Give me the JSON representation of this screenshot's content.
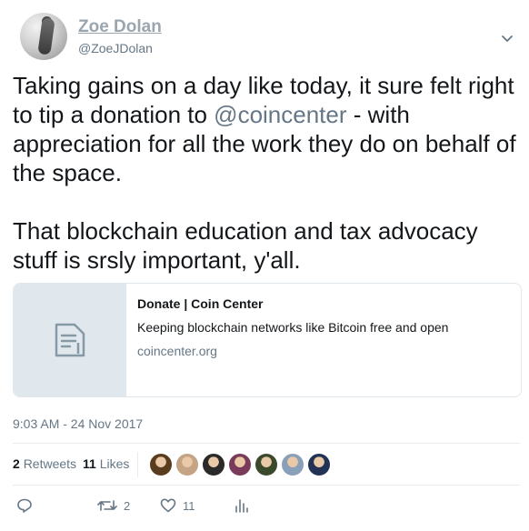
{
  "tweet": {
    "author": {
      "name": "Zoe Dolan",
      "handle": "@ZoeJDolan"
    },
    "text_before": "Taking gains on a day like today, it sure felt right to tip a donation to ",
    "mention": "@coincenter",
    "text_after": " - with appreciation for all the work they do on behalf of the space.\n\nThat blockchain education and tax advocacy stuff is srsly important, y'all.",
    "card": {
      "title": "Donate | Coin Center",
      "description": "Keeping blockchain networks like Bitcoin free and open",
      "domain": "coincenter.org"
    },
    "timestamp": "9:03 AM - 24 Nov 2017",
    "stats": {
      "retweets_count": "2",
      "retweets_label": "Retweets",
      "likes_count": "11",
      "likes_label": "Likes"
    },
    "liker_avatars": [
      "#5a3d1e",
      "#c4a484",
      "#2a2a2a",
      "#7a3b5a",
      "#3c4a2c",
      "#8aa0b8",
      "#223355"
    ],
    "actions": {
      "reply_icon": "reply-icon",
      "retweet_count": "2",
      "like_count": "11",
      "analytics_icon": "analytics-icon"
    },
    "colors": {
      "muted": "#657786",
      "mention": "#657786",
      "border": "#e1e8ed"
    }
  }
}
